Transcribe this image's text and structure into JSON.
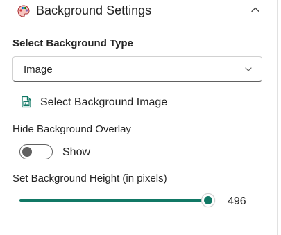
{
  "header": {
    "title": "Background Settings",
    "icon": "palette-icon",
    "collapse_icon": "chevron-up-icon"
  },
  "background_type": {
    "label": "Select Background Type",
    "selected": "Image",
    "chevron_icon": "chevron-down-icon"
  },
  "image_picker": {
    "label": "Select Background Image",
    "icon": "image-icon"
  },
  "overlay": {
    "label": "Hide Background Overlay",
    "toggle_state": false,
    "toggle_label": "Show"
  },
  "height": {
    "label": "Set Background Height (in pixels)",
    "value": "496",
    "fill_fraction": 1.0
  },
  "colors": {
    "accent": "#117865",
    "text": "#242424",
    "border": "#d1d1d1"
  }
}
